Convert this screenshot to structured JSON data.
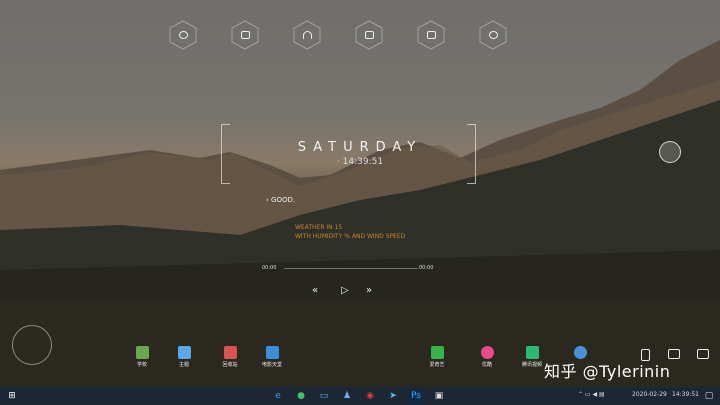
{
  "top_dock": {
    "icons": [
      "globe-icon",
      "camera-icon",
      "headphones-icon",
      "mail-icon",
      "image-icon",
      "settings-icon"
    ]
  },
  "clock": {
    "day": "SATURDAY",
    "time": "14:39:51"
  },
  "greeting": "GOOD",
  "weather": {
    "line1": "WEATHER IN 15",
    "line2": "WITH HUMIDITY % AND WIND SPEED"
  },
  "player": {
    "elapsed": "00:00",
    "duration": "00:00"
  },
  "apps": [
    {
      "label": "学校",
      "color": "#6aa84f"
    },
    {
      "label": "主题",
      "color": "#5aa9e6"
    },
    {
      "label": "回收站",
      "color": "#d9534f"
    },
    {
      "label": "电影天堂",
      "color": "#3b8fd9"
    },
    {
      "label": "爱奇艺",
      "color": "#37b34a"
    },
    {
      "label": "优酷",
      "color": "#e84a8a"
    },
    {
      "label": "腾讯视频",
      "color": "#2eb872"
    },
    {
      "label": "",
      "color": "#4a90d9"
    }
  ],
  "watermark": "知乎 @Tylerinin",
  "taskbar": {
    "date": "2020-02-29",
    "time": "14:39:51",
    "apps": [
      "edge-icon",
      "wechat-icon",
      "monitor-icon",
      "qq-icon",
      "netease-music-icon",
      "feishu-icon",
      "photoshop-icon",
      "terminal-icon"
    ]
  }
}
